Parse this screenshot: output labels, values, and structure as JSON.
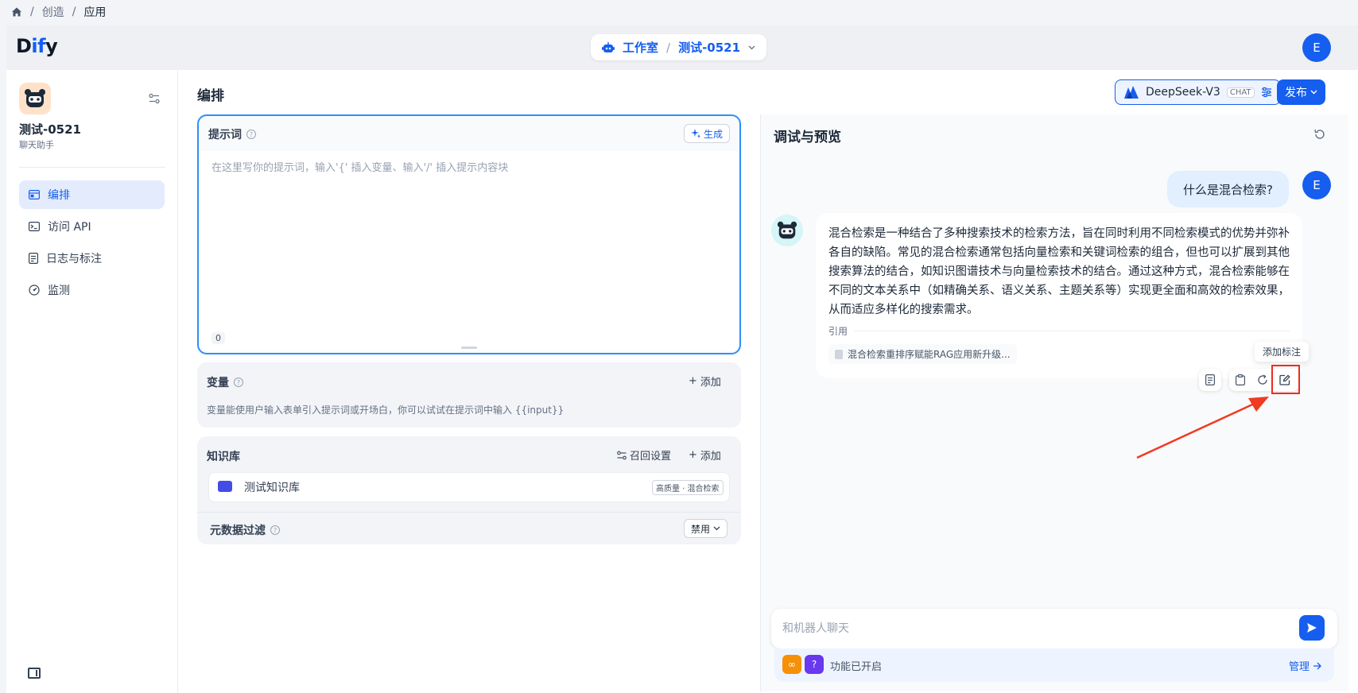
{
  "breadcrumb": {
    "items": [
      "创造",
      "应用"
    ],
    "separator": "/"
  },
  "brand": {
    "logo_prefix": "D",
    "logo_mid": "if",
    "logo_suffix": "y"
  },
  "header": {
    "workspace": "工作室",
    "app": "测试-0521",
    "user_initial": "E"
  },
  "sidebar": {
    "app_name": "测试-0521",
    "app_type": "聊天助手",
    "items": [
      {
        "label": "编排",
        "icon": "layout-icon",
        "active": true
      },
      {
        "label": "访问 API",
        "icon": "terminal-icon",
        "active": false
      },
      {
        "label": "日志与标注",
        "icon": "doc-icon",
        "active": false
      },
      {
        "label": "监测",
        "icon": "gauge-icon",
        "active": false
      }
    ]
  },
  "orchestrate": {
    "title": "编排",
    "model": {
      "name": "DeepSeek-V3",
      "tag": "CHAT"
    },
    "publish": "发布",
    "prompt": {
      "title": "提示词",
      "generate": "生成",
      "placeholder": "在这里写你的提示词，输入'{' 插入变量、输入'/' 插入提示内容块",
      "count": "0"
    },
    "variables": {
      "title": "变量",
      "add": "添加",
      "desc": "变量能使用户输入表单引入提示词或开场白，你可以试试在提示词中输入 {{input}}"
    },
    "knowledge": {
      "title": "知识库",
      "retrieval": "召回设置",
      "add": "添加",
      "item": "测试知识库",
      "item_tag": "高质量 · 混合检索"
    },
    "metadata": {
      "title": "元数据过滤",
      "value": "禁用"
    }
  },
  "debug": {
    "title": "调试与预览",
    "user_message": "什么是混合检索?",
    "answer": "混合检索是一种结合了多种搜索技术的检索方法，旨在同时利用不同检索模式的优势并弥补各自的缺陷。常见的混合检索通常包括向量检索和关键词检索的组合，但也可以扩展到其他搜索算法的结合，如知识图谱技术与向量检索技术的结合。通过这种方式，混合检索能够在不同的文本关系中（如精确关系、语义关系、主题关系等）实现更全面和高效的检索效果，从而适应多样化的搜索需求。",
    "citation_label": "引用",
    "citation": "混合检索重排序赋能RAG应用新升级...",
    "tooltip": "添加标注",
    "input_placeholder": "和机器人聊天",
    "features_enabled": "功能已开启",
    "manage": "管理"
  },
  "colors": {
    "accent": "#155eef",
    "highlight": "#ef2c1f",
    "arrow": "#f03a22"
  }
}
